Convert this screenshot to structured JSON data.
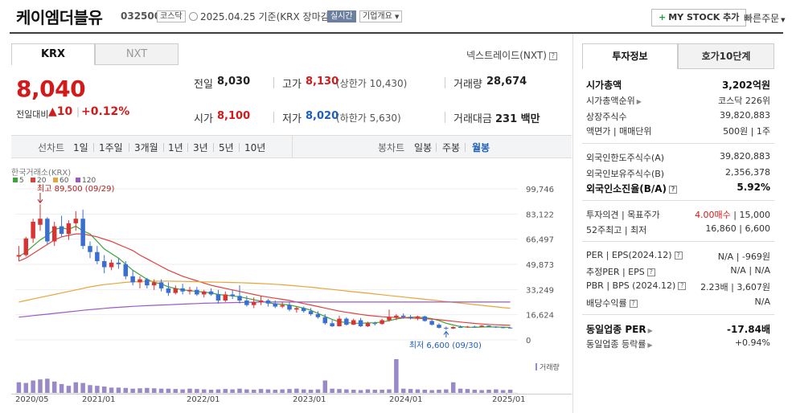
{
  "header": {
    "stock_name": "케이엠더블유",
    "stock_code": "032500",
    "market": "코스닥",
    "date_text": "2025.04.25  기준(KRX 장마감)",
    "realtime": "실시간",
    "company_overview": "기업개요",
    "my_stock": "MY STOCK 추가",
    "quick_order": "빠른주문"
  },
  "market_tabs": {
    "krx": "KRX",
    "nxt": "NXT",
    "nxt_link": "넥스트레이드(NXT)"
  },
  "price": {
    "current": "8,040",
    "change_label": "전일대비",
    "change": "▲10",
    "change_sep": "|",
    "change_pct": "+0.12%"
  },
  "quote": {
    "prev_label": "전일",
    "prev": "8,030",
    "high_label": "고가",
    "high": "8,130",
    "upper_limit": "(상한가 10,430)",
    "volume_label": "거래량",
    "volume": "28,674",
    "open_label": "시가",
    "open": "8,100",
    "low_label": "저가",
    "low": "8,020",
    "lower_limit": "(하한가 5,630)",
    "amount_label": "거래대금",
    "amount": "231",
    "amount_unit": "백만"
  },
  "period_bar": {
    "line_chart": "선차트",
    "periods": [
      "1일",
      "1주일",
      "3개월",
      "1년",
      "3년",
      "5년",
      "10년"
    ],
    "candle_chart": "봉차트",
    "candles": [
      "일봉",
      "주봉",
      "월봉"
    ],
    "selected_candle": "월봉"
  },
  "chart": {
    "source_label": "한국거래소(KRX)",
    "ma_legend": [
      {
        "label": "5",
        "color": "#3aa534"
      },
      {
        "label": "20",
        "color": "#e0403c"
      },
      {
        "label": "60",
        "color": "#e8a43a"
      },
      {
        "label": "120",
        "color": "#9b59c6"
      }
    ],
    "max_label": "최고 89,500 (09/29)",
    "min_label": "최저 6,600 (09/30)",
    "y_ticks": [
      "99,746",
      "83,122",
      "66,497",
      "49,873",
      "33,249",
      "16,624",
      "0"
    ],
    "x_ticks": [
      "2020/05",
      "2021/01",
      "2022/01",
      "2023/01",
      "2024/01",
      "2025/01"
    ],
    "volume_label": "거래량",
    "up_color": "#d93434",
    "down_color": "#3a6fd0"
  },
  "chart_data": {
    "type": "candlestick",
    "interval": "monthly",
    "ylim": [
      0,
      99746
    ],
    "candles": [
      {
        "o": 55000,
        "h": 62000,
        "l": 52000,
        "c": 56000
      },
      {
        "o": 56000,
        "h": 68000,
        "l": 55000,
        "c": 67000
      },
      {
        "o": 67000,
        "h": 80000,
        "l": 64000,
        "c": 78000
      },
      {
        "o": 76000,
        "h": 89500,
        "l": 72000,
        "c": 80000
      },
      {
        "o": 80000,
        "h": 81000,
        "l": 63000,
        "c": 65000
      },
      {
        "o": 65000,
        "h": 78000,
        "l": 62000,
        "c": 75000
      },
      {
        "o": 75000,
        "h": 82000,
        "l": 68000,
        "c": 70000
      },
      {
        "o": 70000,
        "h": 79000,
        "l": 66000,
        "c": 77000
      },
      {
        "o": 77000,
        "h": 85000,
        "l": 72000,
        "c": 80000
      },
      {
        "o": 80000,
        "h": 86000,
        "l": 60000,
        "c": 62000
      },
      {
        "o": 62000,
        "h": 65000,
        "l": 54000,
        "c": 58000
      },
      {
        "o": 58000,
        "h": 62000,
        "l": 50000,
        "c": 52000
      },
      {
        "o": 52000,
        "h": 56000,
        "l": 44000,
        "c": 48000
      },
      {
        "o": 48000,
        "h": 53000,
        "l": 46000,
        "c": 51000
      },
      {
        "o": 51000,
        "h": 54000,
        "l": 47000,
        "c": 50000
      },
      {
        "o": 50000,
        "h": 52000,
        "l": 40000,
        "c": 42000
      },
      {
        "o": 42000,
        "h": 46000,
        "l": 36000,
        "c": 38000
      },
      {
        "o": 38000,
        "h": 42000,
        "l": 34000,
        "c": 40000
      },
      {
        "o": 40000,
        "h": 41000,
        "l": 34000,
        "c": 36000
      },
      {
        "o": 36000,
        "h": 40000,
        "l": 33000,
        "c": 38000
      },
      {
        "o": 38000,
        "h": 40000,
        "l": 32000,
        "c": 34000
      },
      {
        "o": 34000,
        "h": 38000,
        "l": 29000,
        "c": 31000
      },
      {
        "o": 31000,
        "h": 36000,
        "l": 30000,
        "c": 34000
      },
      {
        "o": 34000,
        "h": 37000,
        "l": 30000,
        "c": 32000
      },
      {
        "o": 32000,
        "h": 35000,
        "l": 30000,
        "c": 33000
      },
      {
        "o": 33000,
        "h": 35000,
        "l": 29000,
        "c": 30000
      },
      {
        "o": 30000,
        "h": 33000,
        "l": 28000,
        "c": 32000
      },
      {
        "o": 32000,
        "h": 34000,
        "l": 29000,
        "c": 30000
      },
      {
        "o": 30000,
        "h": 33000,
        "l": 24000,
        "c": 26000
      },
      {
        "o": 26000,
        "h": 32000,
        "l": 25000,
        "c": 30000
      },
      {
        "o": 30000,
        "h": 33000,
        "l": 27000,
        "c": 29000
      },
      {
        "o": 29000,
        "h": 36000,
        "l": 24000,
        "c": 26000
      },
      {
        "o": 26000,
        "h": 29000,
        "l": 22000,
        "c": 23000
      },
      {
        "o": 23000,
        "h": 28000,
        "l": 21000,
        "c": 25000
      },
      {
        "o": 25000,
        "h": 29000,
        "l": 23000,
        "c": 26000
      },
      {
        "o": 26000,
        "h": 27000,
        "l": 22000,
        "c": 24000
      },
      {
        "o": 24000,
        "h": 26000,
        "l": 21000,
        "c": 22000
      },
      {
        "o": 22000,
        "h": 25000,
        "l": 21000,
        "c": 23000
      },
      {
        "o": 23000,
        "h": 25000,
        "l": 19000,
        "c": 20000
      },
      {
        "o": 20000,
        "h": 22000,
        "l": 18000,
        "c": 21000
      },
      {
        "o": 21000,
        "h": 22000,
        "l": 18000,
        "c": 19000
      },
      {
        "o": 19000,
        "h": 21000,
        "l": 16000,
        "c": 17000
      },
      {
        "o": 17000,
        "h": 19000,
        "l": 14000,
        "c": 15000
      },
      {
        "o": 15000,
        "h": 17000,
        "l": 10000,
        "c": 11000
      },
      {
        "o": 11000,
        "h": 13000,
        "l": 8500,
        "c": 9000
      },
      {
        "o": 9000,
        "h": 16000,
        "l": 8800,
        "c": 14000
      },
      {
        "o": 14000,
        "h": 15000,
        "l": 9500,
        "c": 10000
      },
      {
        "o": 10000,
        "h": 14000,
        "l": 9800,
        "c": 13000
      },
      {
        "o": 13000,
        "h": 14500,
        "l": 8500,
        "c": 9000
      },
      {
        "o": 9000,
        "h": 12000,
        "l": 8500,
        "c": 11000
      },
      {
        "o": 11000,
        "h": 12000,
        "l": 9500,
        "c": 10500
      },
      {
        "o": 10500,
        "h": 14000,
        "l": 10000,
        "c": 13000
      },
      {
        "o": 13000,
        "h": 20000,
        "l": 12000,
        "c": 15000
      },
      {
        "o": 15000,
        "h": 17000,
        "l": 13000,
        "c": 16000
      },
      {
        "o": 16000,
        "h": 17500,
        "l": 14000,
        "c": 15000
      },
      {
        "o": 15000,
        "h": 16500,
        "l": 13500,
        "c": 14500
      },
      {
        "o": 14500,
        "h": 16000,
        "l": 13000,
        "c": 15500
      },
      {
        "o": 15500,
        "h": 16000,
        "l": 12000,
        "c": 12500
      },
      {
        "o": 12500,
        "h": 13500,
        "l": 9500,
        "c": 10000
      },
      {
        "o": 10000,
        "h": 11000,
        "l": 7500,
        "c": 8000
      },
      {
        "o": 8000,
        "h": 8800,
        "l": 6600,
        "c": 7500
      },
      {
        "o": 7500,
        "h": 9000,
        "l": 7200,
        "c": 8500
      },
      {
        "o": 8500,
        "h": 9500,
        "l": 7800,
        "c": 8200
      },
      {
        "o": 8200,
        "h": 9200,
        "l": 7900,
        "c": 8800
      },
      {
        "o": 8800,
        "h": 9400,
        "l": 8200,
        "c": 8600
      },
      {
        "o": 8600,
        "h": 9800,
        "l": 8300,
        "c": 9400
      },
      {
        "o": 9400,
        "h": 9600,
        "l": 8400,
        "c": 8700
      },
      {
        "o": 8700,
        "h": 9000,
        "l": 7900,
        "c": 8300
      },
      {
        "o": 8300,
        "h": 8800,
        "l": 7800,
        "c": 8000
      },
      {
        "o": 8100,
        "h": 8300,
        "l": 7600,
        "c": 8040
      }
    ],
    "volumes": [
      30,
      28,
      35,
      38,
      40,
      32,
      25,
      20,
      30,
      28,
      22,
      20,
      18,
      15,
      15,
      14,
      12,
      13,
      14,
      13,
      12,
      12,
      11,
      10,
      12,
      11,
      10,
      9,
      10,
      11,
      10,
      12,
      10,
      9,
      11,
      10,
      9,
      10,
      11,
      12,
      10,
      9,
      10,
      35,
      12,
      11,
      10,
      9,
      8,
      10,
      9,
      9,
      10,
      95,
      12,
      11,
      10,
      9,
      8,
      9,
      10,
      30,
      12,
      11,
      9,
      8,
      9,
      10,
      8,
      9
    ],
    "ma_series": {
      "ma5": [
        55000,
        58000,
        62000,
        66000,
        69000,
        73000,
        74000,
        73000,
        75000,
        72000,
        70000,
        65000,
        60000,
        57000,
        54000,
        50000,
        46000,
        43000,
        40000,
        38000,
        37000,
        35000,
        34000,
        33000,
        32500,
        32000,
        31500,
        31000,
        30000,
        29500,
        29000,
        28500,
        27500,
        26500,
        25500,
        24500,
        23800,
        23500,
        23000,
        22000,
        21000,
        19500,
        17500,
        15500,
        13500,
        12000,
        11500,
        11000,
        11000,
        11200,
        11300,
        11800,
        12700,
        13800,
        14500,
        15000,
        15000,
        14700,
        14000,
        12800,
        11000,
        9800,
        8800,
        8400,
        8300,
        8500,
        8600,
        8500,
        8400,
        8250
      ],
      "ma20": [
        52000,
        54000,
        57000,
        60000,
        63000,
        66000,
        68000,
        69000,
        70000,
        70000,
        69000,
        68000,
        66500,
        65000,
        63000,
        61000,
        59000,
        56000,
        53500,
        51000,
        48500,
        46000,
        44000,
        42000,
        40500,
        39000,
        37500,
        36000,
        35000,
        34000,
        33000,
        32000,
        31000,
        30000,
        29000,
        28200,
        27500,
        26800,
        26000,
        25000,
        24000,
        23000,
        22000,
        21000,
        20000,
        19000,
        18200,
        17500,
        16800,
        16200,
        15700,
        15300,
        15000,
        14800,
        14600,
        14400,
        14200,
        14000,
        13700,
        13300,
        12800,
        12300,
        11800,
        11300,
        10900,
        10500,
        10200,
        10000,
        9800,
        9600
      ],
      "ma60": [
        25000,
        26000,
        27000,
        28000,
        29000,
        30000,
        31000,
        32000,
        33000,
        34000,
        35000,
        35800,
        36500,
        37000,
        37500,
        38000,
        38300,
        38500,
        38600,
        38700,
        38800,
        38800,
        38700,
        38600,
        38500,
        38400,
        38300,
        38200,
        38100,
        38000,
        37900,
        37800,
        37600,
        37400,
        37200,
        37000,
        36700,
        36400,
        36000,
        35600,
        35200,
        34800,
        34300,
        33800,
        33300,
        32800,
        32300,
        31800,
        31300,
        30800,
        30300,
        29800,
        29300,
        28800,
        28300,
        27800,
        27300,
        26800,
        26300,
        25800,
        25300,
        24800,
        24300,
        23800,
        23300,
        22800,
        22300,
        21800,
        21300,
        20900
      ],
      "ma120": [
        15000,
        15500,
        16000,
        16500,
        17000,
        17500,
        18000,
        18500,
        19000,
        19500,
        20000,
        20400,
        20800,
        21200,
        21500,
        21800,
        22100,
        22400,
        22600,
        22800,
        23000,
        23200,
        23400,
        23600,
        23800,
        24000,
        24200,
        24300,
        24400,
        24500,
        24600,
        24700,
        24800,
        24900,
        25000,
        25000,
        25000,
        25000,
        25000,
        25000,
        25000,
        25000,
        25000,
        25000,
        25000,
        25000,
        25000,
        25000,
        25000,
        25000,
        25000,
        25000,
        25000,
        25000,
        25000,
        25000,
        25000,
        25000,
        25000,
        25000,
        25000,
        25000,
        25000,
        25000,
        25000,
        25000,
        25000,
        25000,
        25000,
        25000
      ]
    }
  },
  "right_panel": {
    "tab_info": "투자정보",
    "tab_hoga": "호가10단계",
    "rows": {
      "market_cap_label": "시가총액",
      "market_cap": "3,202억원",
      "cap_rank_label": "시가총액순위",
      "cap_rank": "코스닥 226위",
      "shares_label": "상장주식수",
      "shares": "39,820,883",
      "par_label": "액면가 | 매매단위",
      "par": "500원 | 1주",
      "foreign_limit_label": "외국인한도주식수(A)",
      "foreign_limit": "39,820,883",
      "foreign_hold_label": "외국인보유주식수(B)",
      "foreign_hold": "2,356,378",
      "foreign_ratio_label": "외국인소진율(B/A)",
      "foreign_ratio": "5.92%",
      "opinion_label": "투자의견 | 목표주가",
      "opinion": "4.00매수",
      "target": "15,000",
      "week52_label": "52주최고 | 최저",
      "week52": "16,860 | 6,600",
      "per_label": "PER | EPS(2024.12)",
      "per": "N/A | -969원",
      "est_per_label": "추정PER | EPS",
      "est_per": "N/A | N/A",
      "pbr_label": "PBR | BPS (2024.12)",
      "pbr": "2.23배 | 3,607원",
      "div_label": "배당수익률",
      "div": "N/A",
      "sector_per_label": "동일업종 PER",
      "sector_per": "-17.84배",
      "sector_chg_label": "동일업종 등락률",
      "sector_chg": "+0.94%"
    }
  }
}
